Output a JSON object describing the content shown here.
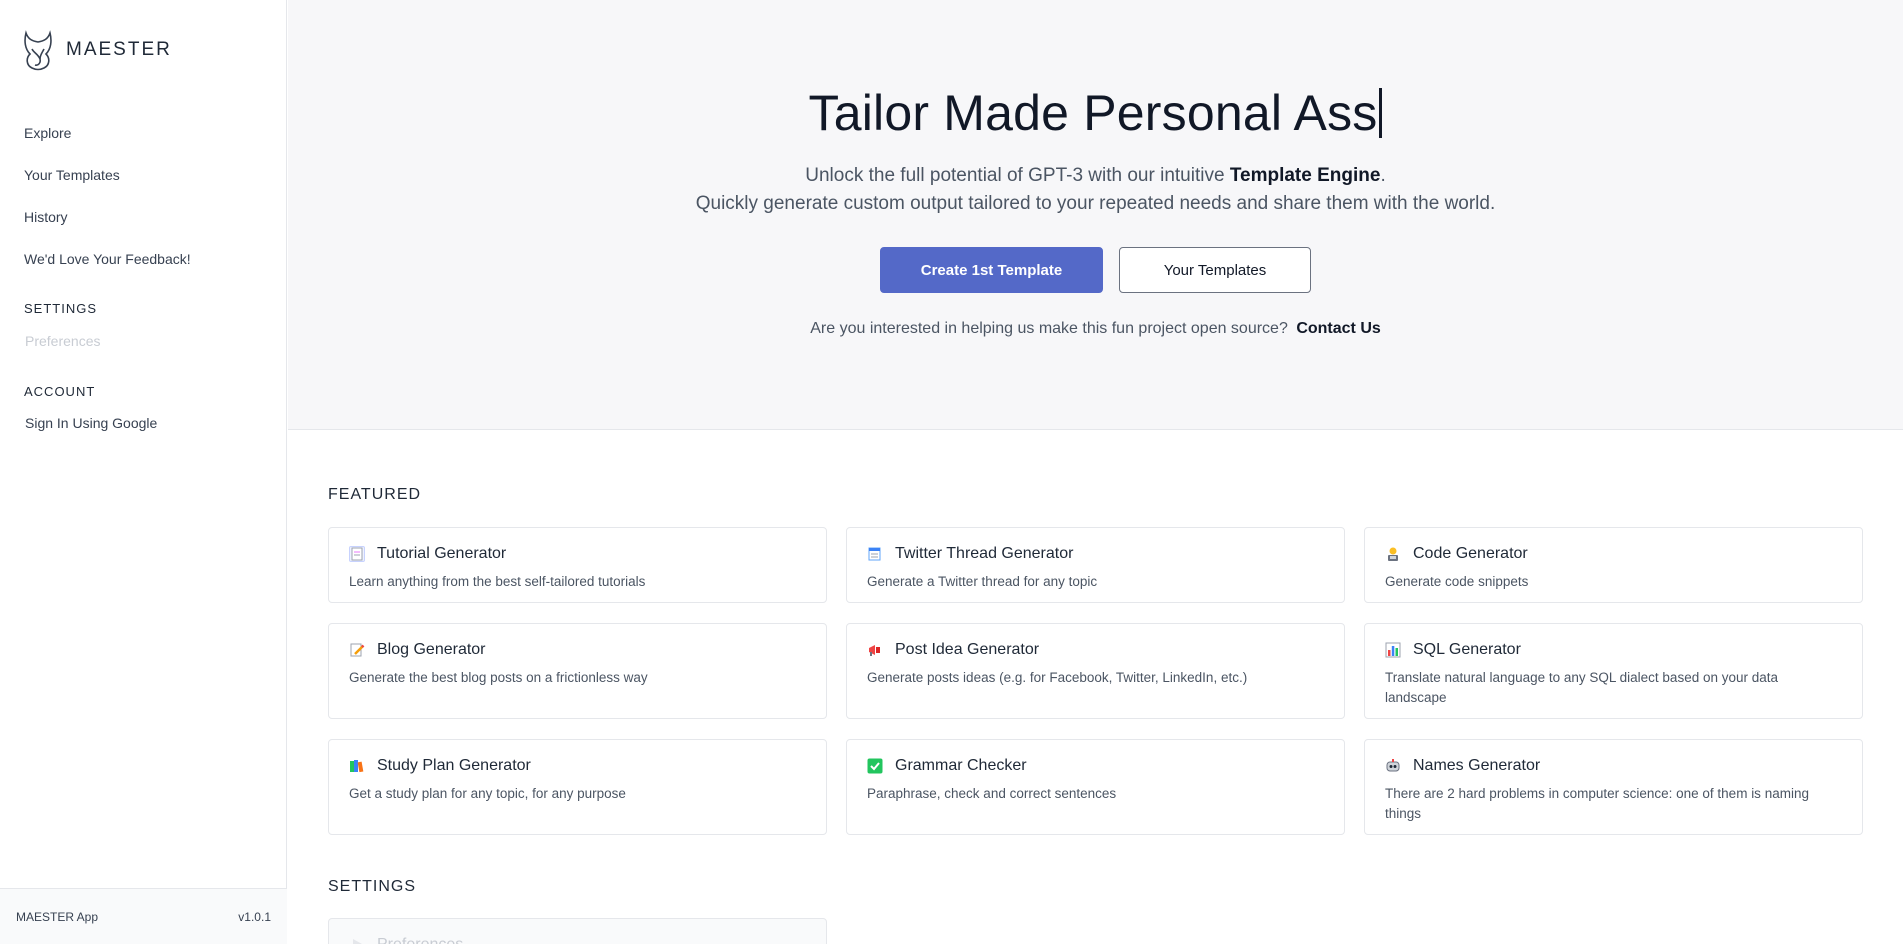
{
  "brand": {
    "name": "MAESTER"
  },
  "sidebar": {
    "nav": [
      {
        "label": "Explore"
      },
      {
        "label": "Your Templates"
      },
      {
        "label": "History"
      },
      {
        "label": "We'd Love Your Feedback!"
      }
    ],
    "settings_heading": "SETTINGS",
    "settings_item": "Preferences",
    "account_heading": "ACCOUNT",
    "account_item": "Sign In Using Google",
    "footer_app": "MAESTER App",
    "footer_version": "v1.0.1"
  },
  "hero": {
    "title": "Tailor Made Personal Ass",
    "sub_line1_prefix": "Unlock the full potential of GPT-3 with our intuitive",
    "sub_line1_bold": "Template Engine",
    "sub_line1_suffix": ".",
    "sub_line2": "Quickly generate custom output tailored to your repeated needs and share them with the world.",
    "primary_button": "Create 1st Template",
    "secondary_button": "Your Templates",
    "cta_text": "Are you interested in helping us make this fun project open source?",
    "cta_link": "Contact Us"
  },
  "featured": {
    "heading": "FEATURED",
    "cards": [
      {
        "title": "Tutorial Generator",
        "desc": "Learn anything from the best self-tailored tutorials",
        "icon": "document-icon"
      },
      {
        "title": "Twitter Thread Generator",
        "desc": "Generate a Twitter thread for any topic",
        "icon": "memo-icon"
      },
      {
        "title": "Code Generator",
        "desc": "Generate code snippets",
        "icon": "technologist-icon"
      },
      {
        "title": "Blog Generator",
        "desc": "Generate the best blog posts on a frictionless way",
        "icon": "pencil-icon"
      },
      {
        "title": "Post Idea Generator",
        "desc": "Generate posts ideas (e.g. for Facebook, Twitter, LinkedIn, etc.)",
        "icon": "megaphone-icon"
      },
      {
        "title": "SQL Generator",
        "desc": "Translate natural language to any SQL dialect based on your data landscape",
        "icon": "bar-chart-icon"
      },
      {
        "title": "Study Plan Generator",
        "desc": "Get a study plan for any topic, for any purpose",
        "icon": "books-icon"
      },
      {
        "title": "Grammar Checker",
        "desc": "Paraphrase, check and correct sentences",
        "icon": "checkmark-icon"
      },
      {
        "title": "Names Generator",
        "desc": "There are 2 hard problems in computer science: one of them is naming things",
        "icon": "robot-icon"
      }
    ]
  },
  "settings_section": {
    "heading": "SETTINGS",
    "card_title": "Preferences"
  }
}
